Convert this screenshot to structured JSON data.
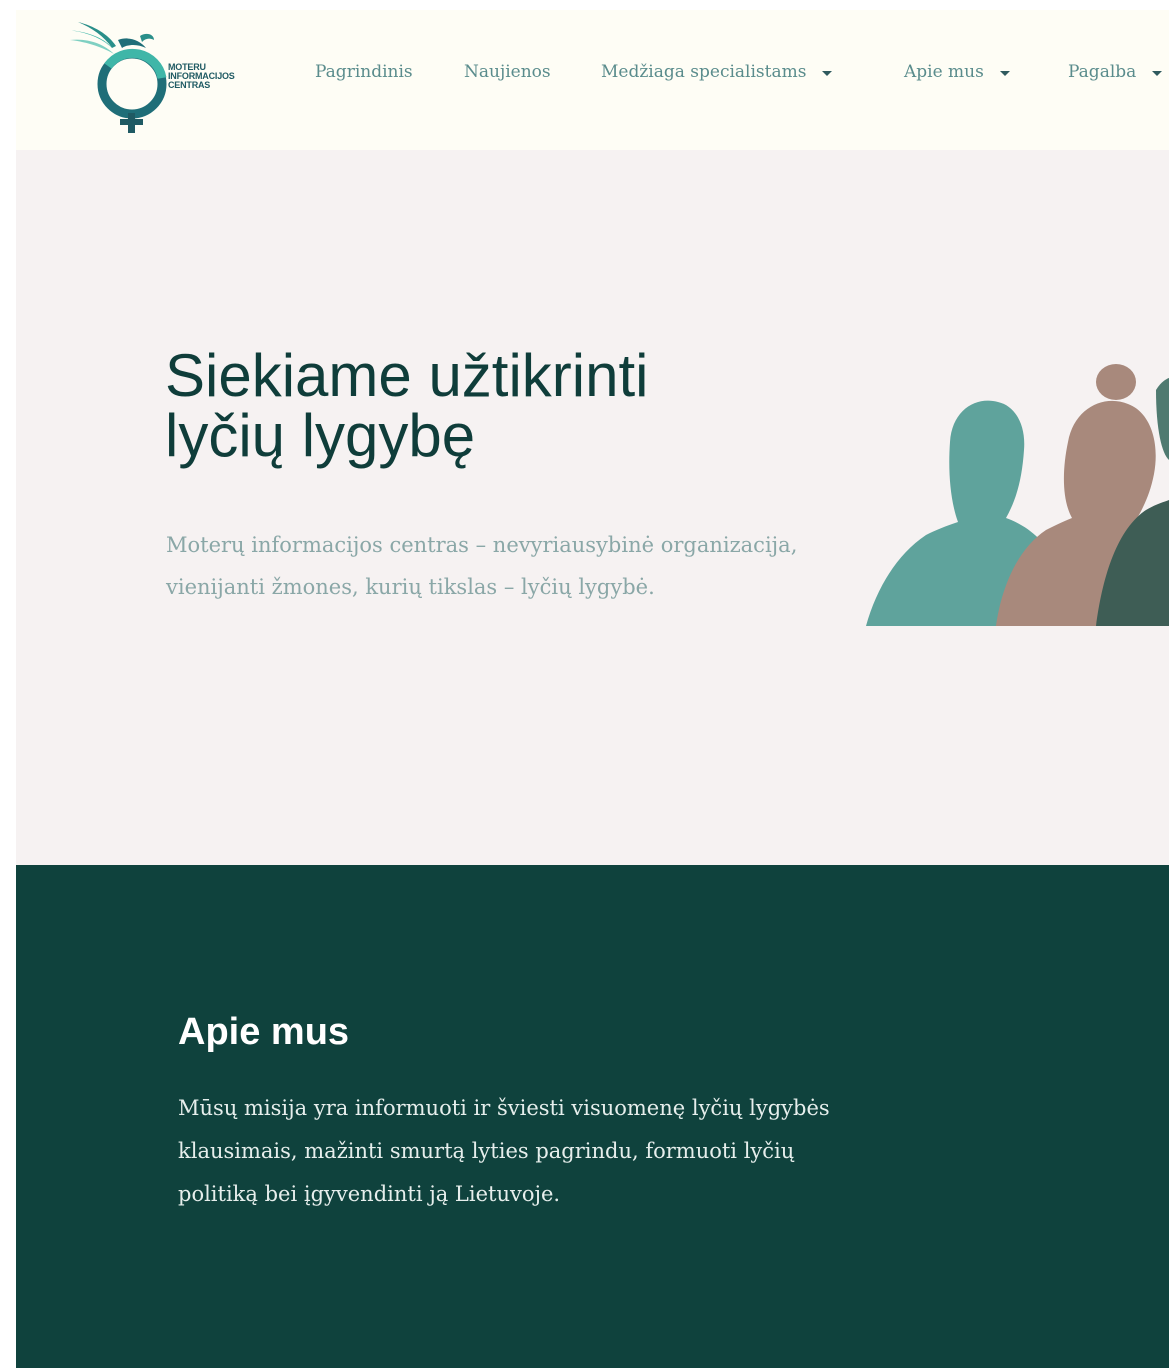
{
  "header": {
    "logo": {
      "lines": [
        "MOTERU",
        "INFORMACIJOS",
        "CENTRAS"
      ],
      "colors": {
        "primary": "#1f6e78",
        "accent": "#3fb6a8",
        "light": "#7fd0c2"
      }
    },
    "nav": [
      {
        "label": "Pagrindinis",
        "has_dropdown": false
      },
      {
        "label": "Naujienos",
        "has_dropdown": false
      },
      {
        "label": "Medžiaga specialistams",
        "has_dropdown": true
      },
      {
        "label": "Apie mus",
        "has_dropdown": true
      },
      {
        "label": "Pagalba",
        "has_dropdown": true
      }
    ]
  },
  "hero": {
    "title_line1": "Siekiame užtikrinti",
    "title_line2": "lyčių lygybę",
    "description": "Moterų informacijos centras – nevyriausybinė organizacija, vienijanti žmones, kurių tikslas – lyčių lygybė.",
    "illustration": "people-silhouettes-illustration"
  },
  "about": {
    "title": "Apie mus",
    "text": "Mūsų misija yra informuoti ir šviesti visuomenę lyčių lygybės klausimais, mažinti smurtą lyties pagrindu, formuoti lyčių politiką bei įgyvendinti ją Lietuvoje."
  },
  "colors": {
    "header_bg": "#fefdf5",
    "hero_bg": "#f6f2f2",
    "title_color": "#0f3d3a",
    "nav_color": "#5a8c8c",
    "about_bg": "#0f423d"
  }
}
